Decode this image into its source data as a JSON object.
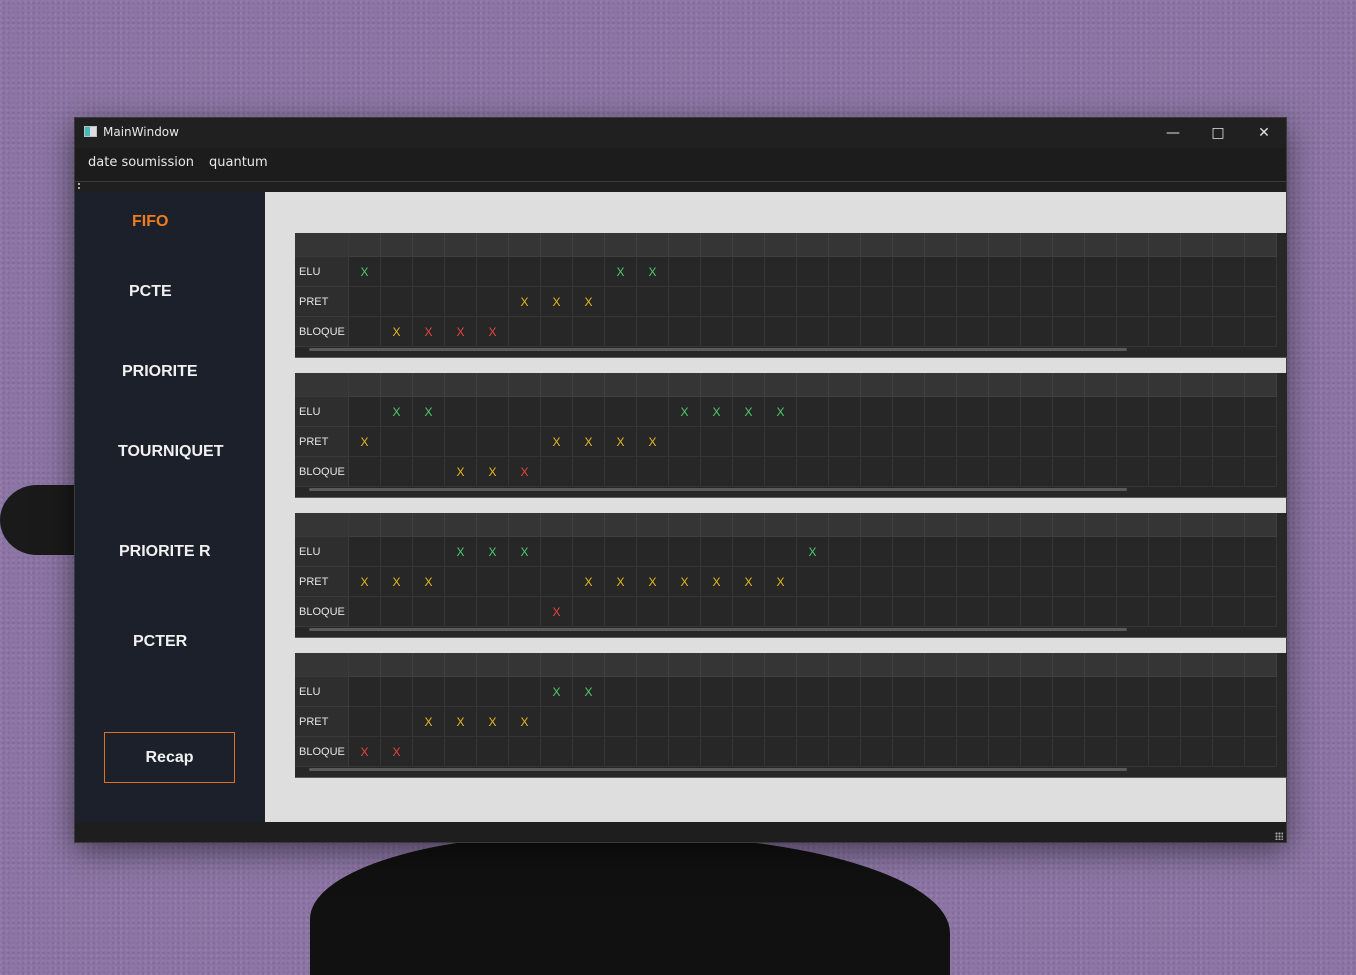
{
  "window": {
    "title": "MainWindow"
  },
  "menu": {
    "items": [
      "date soumission",
      "quantum"
    ]
  },
  "sidebar": {
    "items": [
      "FIFO",
      "PCTE",
      "PRIORITE",
      "TOURNIQUET",
      "PRIORITE R",
      "PCTER"
    ],
    "active": "FIFO",
    "recap_label": "Recap"
  },
  "colors": {
    "elu": "#4ecb6a",
    "pret": "#e8b620",
    "bloque": "#e8443a",
    "accent": "#f07c1e"
  },
  "row_labels": [
    "ELU",
    "PRET",
    "BLOQUE"
  ],
  "columns": 29,
  "tables": [
    {
      "ELU": [
        0,
        8,
        9
      ],
      "PRET": [
        5,
        6,
        7
      ],
      "BLOQUE": [
        1,
        2,
        3,
        4
      ],
      "BLOQUE_pret_colored": [
        1
      ]
    },
    {
      "ELU": [
        1,
        2,
        10,
        11,
        12,
        13
      ],
      "PRET": [
        0,
        6,
        7,
        8,
        9
      ],
      "BLOQUE": [
        3,
        4,
        5
      ],
      "BLOQUE_pret_colored": [
        3,
        4
      ]
    },
    {
      "ELU": [
        3,
        4,
        5,
        14
      ],
      "PRET": [
        0,
        1,
        2,
        7,
        8,
        9,
        10,
        11,
        12,
        13
      ],
      "BLOQUE": [
        6
      ],
      "BLOQUE_pret_colored": []
    },
    {
      "ELU": [
        6,
        7
      ],
      "PRET": [
        2,
        3,
        4,
        5
      ],
      "BLOQUE": [
        0,
        1
      ],
      "BLOQUE_pret_colored": []
    }
  ],
  "mark": "X"
}
